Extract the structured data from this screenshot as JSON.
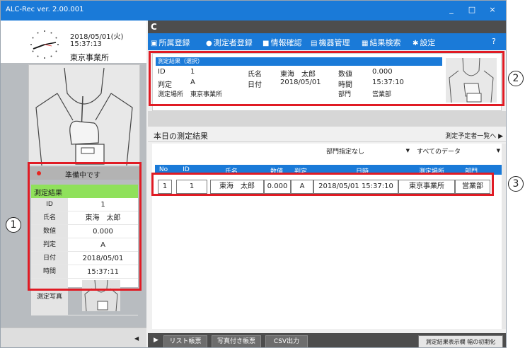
{
  "window": {
    "title": "ALC-Rec  ver. 2.00.001",
    "min": "_",
    "max": "□",
    "close": "×"
  },
  "clock": {
    "date": "2018/05/01(火)",
    "time": "15:37:13",
    "location": "東京事業所"
  },
  "status": {
    "text": "準備中です",
    "dot_color": "#e8251f"
  },
  "result_panel": {
    "header": "測定結果",
    "rows": [
      {
        "label": "ID",
        "value": "1"
      },
      {
        "label": "氏名",
        "value": "東海　太郎"
      },
      {
        "label": "数値",
        "value": "0.000"
      },
      {
        "label": "判定",
        "value": "A"
      },
      {
        "label": "日付",
        "value": "2018/05/01"
      },
      {
        "label": "時間",
        "value": "15:37:11"
      }
    ],
    "photo_label": "測定写真"
  },
  "toolbar": {
    "refresh": "C"
  },
  "menu": {
    "items": [
      {
        "label": "所属登録",
        "icon": "folder-icon"
      },
      {
        "label": "測定者登録",
        "icon": "person-icon"
      },
      {
        "label": "情報確認",
        "icon": "info-icon"
      },
      {
        "label": "機器管理",
        "icon": "device-icon"
      },
      {
        "label": "結果検索",
        "icon": "calendar-icon"
      },
      {
        "label": "設定",
        "icon": "gear-icon"
      }
    ],
    "help": "?"
  },
  "selected": {
    "header": "測定結果（選択）",
    "id_label": "ID",
    "id_value": "1",
    "judge_label": "判定",
    "judge_value": "A",
    "place_label": "測定場所",
    "place_value": "東京事業所",
    "name_label": "氏名",
    "name_value": "東海　太郎",
    "date_label": "日付",
    "date_value": "2018/05/01",
    "num_label": "数値",
    "num_value": "0.000",
    "time_label": "時間",
    "time_value": "15:37:10",
    "dept_label": "部門",
    "dept_value": "営業部"
  },
  "today": {
    "title": "本日の測定結果",
    "schedule_link": "測定予定者一覧へ",
    "filter_dept": "部門指定なし",
    "filter_data": "すべてのデータ",
    "columns": [
      "No",
      "ID",
      "氏名",
      "数値",
      "判定",
      "日時",
      "測定場所",
      "部門"
    ],
    "rows": [
      {
        "no": "1",
        "id": "1",
        "name": "東海　太郎",
        "num": "0.000",
        "judge": "A",
        "datetime": "2018/05/01 15:37:10",
        "place": "東京事業所",
        "dept": "営業部"
      }
    ]
  },
  "bottom": {
    "list_report": "リスト帳票",
    "photo_report": "写真付き帳票",
    "csv": "CSV出力",
    "reset_widths": "測定結果表示欄 幅の初期化"
  },
  "callouts": {
    "one": "1",
    "two": "2",
    "three": "3"
  }
}
